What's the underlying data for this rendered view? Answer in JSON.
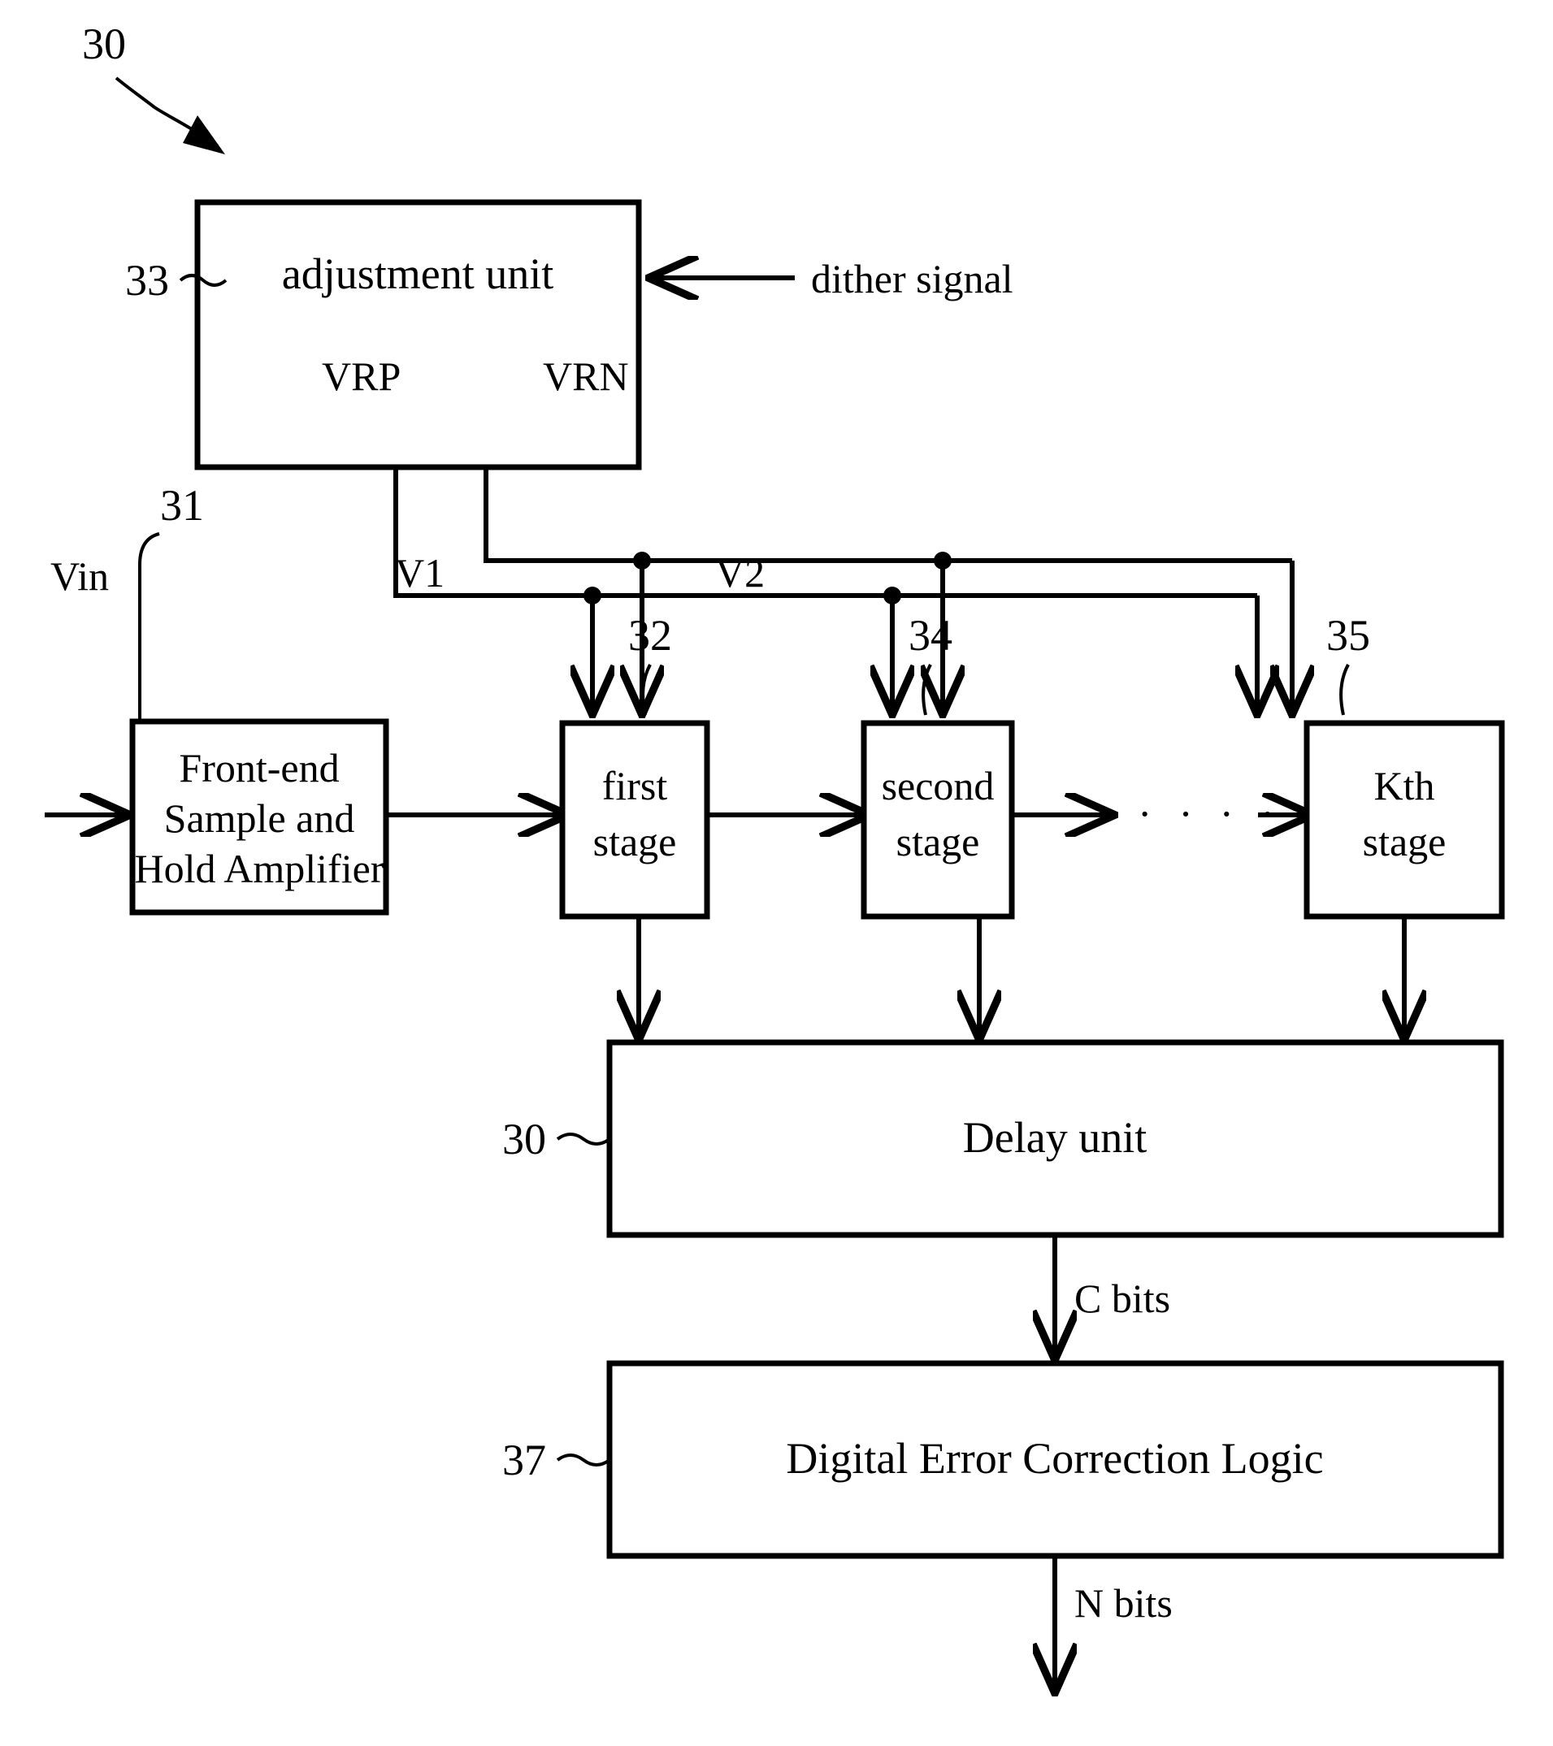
{
  "figure": {
    "top_reference": "30",
    "blocks": {
      "adjustment_unit": {
        "label": "adjustment unit",
        "ref": "33"
      },
      "front_end": {
        "line1": "Front-end",
        "line2": "Sample and",
        "line3": "Hold Amplifier",
        "ref": "31"
      },
      "first_stage": {
        "line1": "first",
        "line2": "stage",
        "ref": "32"
      },
      "second_stage": {
        "line1": "second",
        "line2": "stage",
        "ref": "34"
      },
      "kth_stage": {
        "line1": "Kth",
        "line2": "stage",
        "ref": "35"
      },
      "delay_unit": {
        "label": "Delay unit",
        "ref": "30"
      },
      "error_correction": {
        "label": "Digital Error Correction Logic",
        "ref": "37"
      }
    },
    "signals": {
      "dither": "dither signal",
      "vrp": "VRP",
      "vrn": "VRN",
      "vin": "Vin",
      "v1": "V1",
      "v2": "V2",
      "c_bits": "C bits",
      "n_bits": "N bits",
      "ellipsis": "· · · ·"
    },
    "colors": {
      "stroke": "#000000",
      "fill": "#ffffff"
    }
  }
}
